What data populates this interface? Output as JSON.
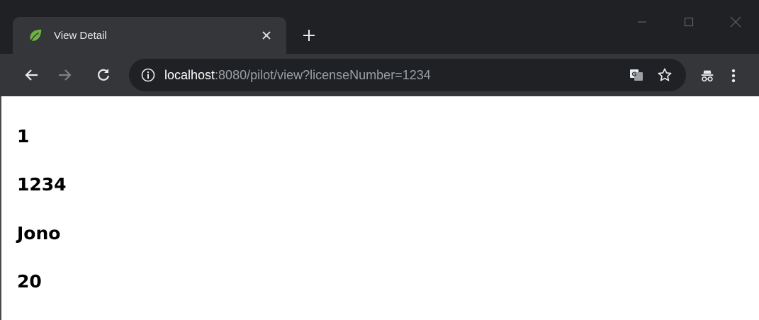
{
  "browser": {
    "tab": {
      "title": "View Detail",
      "favicon": "leaf-icon",
      "favicon_color": "#6db33f"
    },
    "address_bar": {
      "host": "localhost",
      "path": ":8080/pilot/view?licenseNumber=1234"
    },
    "colors": {
      "frame": "#202124",
      "toolbar": "#35363a",
      "omnibox": "#202124",
      "icon": "#e8eaed"
    }
  },
  "page": {
    "values": [
      "1",
      "1234",
      "Jono",
      "20"
    ]
  }
}
